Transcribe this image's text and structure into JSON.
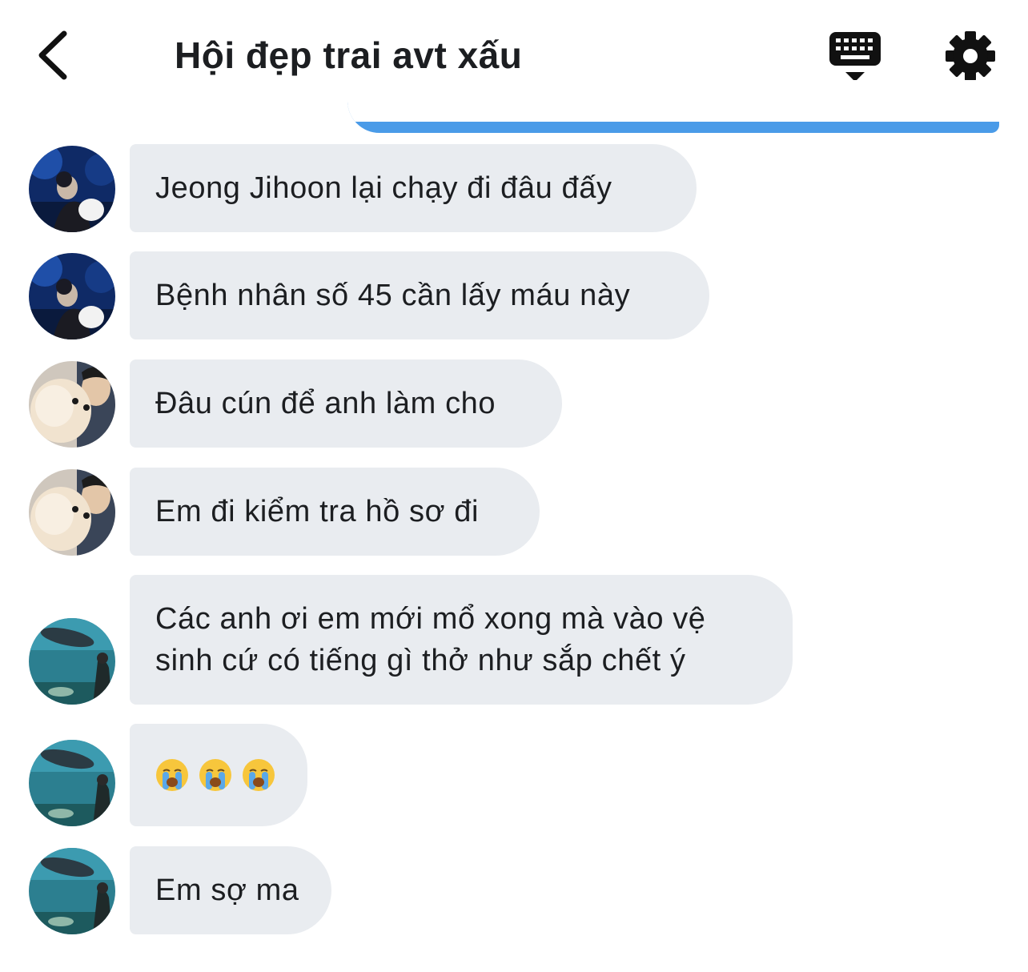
{
  "header": {
    "title": "Hội đẹp trai avt xấu",
    "back_icon": "chevron-left-icon",
    "keyboard_icon": "keyboard-icon",
    "settings_icon": "gear-icon"
  },
  "colors": {
    "bubble_bg": "#e9ecf0",
    "sent_bubble": "#4a9be8",
    "text": "#1c1e21",
    "background": "#ffffff"
  },
  "messages": [
    {
      "sender_avatar": "avatar-blue-night",
      "text": "Jeong Jihoon lại chạy đi đâu đấy"
    },
    {
      "sender_avatar": "avatar-blue-night",
      "text": "Bệnh nhân số 45 cần lấy máu này"
    },
    {
      "sender_avatar": "avatar-dog-selfie",
      "text": "Đâu cún để anh làm cho"
    },
    {
      "sender_avatar": "avatar-dog-selfie",
      "text": "Em đi kiểm tra hồ sơ đi"
    },
    {
      "sender_avatar": "avatar-aquarium",
      "text": "Các anh ơi em mới mổ xong mà vào vệ sinh cứ có tiếng gì thở như sắp chết ý"
    },
    {
      "sender_avatar": "avatar-aquarium",
      "text": "",
      "emojis": [
        "crying-face-emoji",
        "crying-face-emoji",
        "crying-face-emoji"
      ]
    },
    {
      "sender_avatar": "avatar-aquarium",
      "text": "Em sợ ma"
    }
  ]
}
